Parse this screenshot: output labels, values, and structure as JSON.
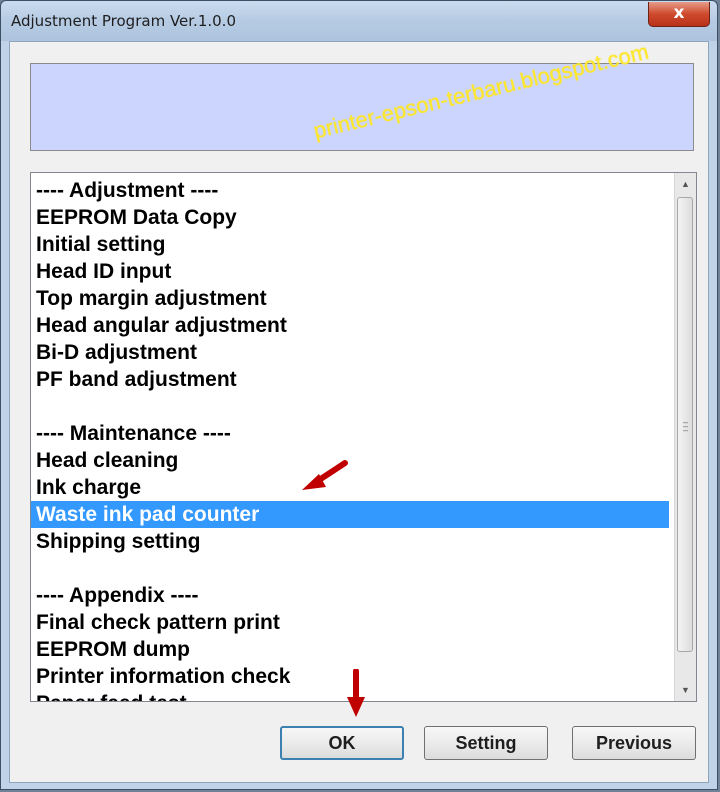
{
  "window": {
    "title": "Adjustment Program Ver.1.0.0",
    "close_label": "x"
  },
  "info_panel": {
    "text": ""
  },
  "list": {
    "items": [
      "---- Adjustment ----",
      "EEPROM Data Copy",
      "Initial setting",
      "Head ID input",
      "Top margin adjustment",
      "Head angular adjustment",
      "Bi-D adjustment",
      "PF band adjustment",
      "",
      "---- Maintenance ----",
      "Head cleaning",
      "Ink charge",
      "Waste ink pad counter",
      "Shipping setting",
      "",
      "---- Appendix ----",
      "Final check pattern print",
      "EEPROM dump",
      "Printer information check",
      "Paper feed test"
    ],
    "selected_index": 12
  },
  "watermark": "printer-epson-terbaru.blogspot.com",
  "buttons": {
    "ok": "OK",
    "setting": "Setting",
    "previous": "Previous"
  },
  "colors": {
    "selection": "#3399ff",
    "info_panel": "#ccd5fd",
    "annotation_arrow": "#c00000",
    "watermark": "#ffe930"
  },
  "icons": {
    "scroll_up": "triangle-up-icon",
    "scroll_down": "triangle-down-icon",
    "annotation": "red-arrow-icon"
  }
}
